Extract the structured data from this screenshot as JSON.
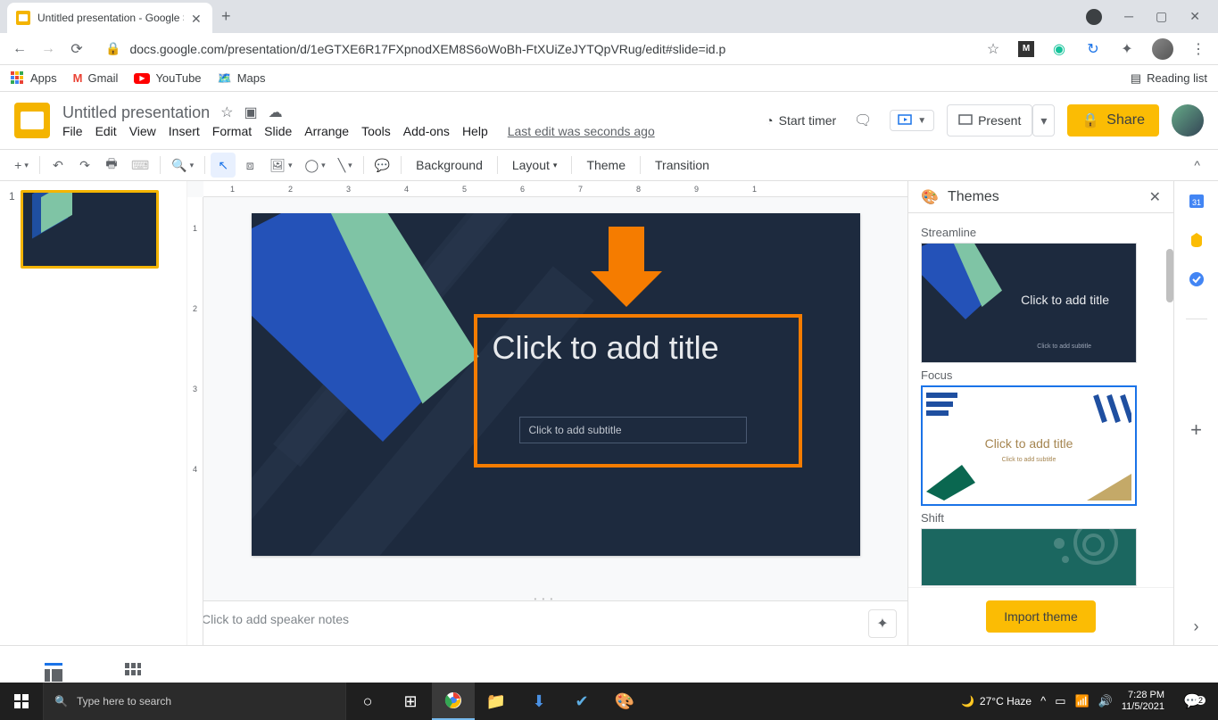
{
  "browser": {
    "tab_title": "Untitled presentation - Google S",
    "url": "docs.google.com/presentation/d/1eGTXE6R17FXpnodXEM8S6oWoBh-FtXUiZeJYTQpVRug/edit#slide=id.p",
    "bookmarks": {
      "apps": "Apps",
      "gmail": "Gmail",
      "youtube": "YouTube",
      "maps": "Maps",
      "reading_list": "Reading list"
    }
  },
  "doc": {
    "title": "Untitled presentation",
    "last_edit": "Last edit was seconds ago",
    "menubar": [
      "File",
      "Edit",
      "View",
      "Insert",
      "Format",
      "Slide",
      "Arrange",
      "Tools",
      "Add-ons",
      "Help"
    ]
  },
  "header": {
    "start_timer": "Start timer",
    "present": "Present",
    "share": "Share"
  },
  "toolbar": {
    "background": "Background",
    "layout": "Layout",
    "theme": "Theme",
    "transition": "Transition"
  },
  "slide": {
    "title_placeholder": "Click to add title",
    "subtitle_placeholder": "Click to add subtitle",
    "speaker_notes_placeholder": "Click to add speaker notes",
    "thumb_number": "1",
    "ruler_marks": "1234567891"
  },
  "themes": {
    "panel_title": "Themes",
    "import": "Import theme",
    "items": [
      {
        "name": "Streamline",
        "title": "Click to add title",
        "sub": "Click to add subtitle"
      },
      {
        "name": "Focus",
        "title": "Click to add title",
        "sub": "Click to add subtitle"
      },
      {
        "name": "Shift",
        "title": "",
        "sub": ""
      }
    ]
  },
  "taskbar": {
    "search_placeholder": "Type here to search",
    "weather": "27°C  Haze",
    "time": "7:28 PM",
    "date": "11/5/2021",
    "notif_count": "2"
  },
  "colors": {
    "slide_bg": "#1d2a3e",
    "blue": "#2452b8",
    "green": "#7fc4a5",
    "orange": "#f57c00",
    "yellow": "#fbbc04"
  }
}
